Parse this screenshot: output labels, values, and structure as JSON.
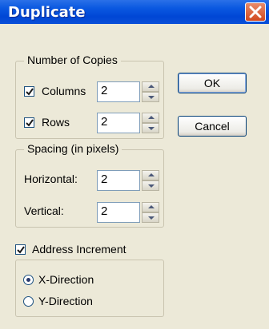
{
  "window": {
    "title": "Duplicate"
  },
  "copies_group": {
    "label": "Number of Copies",
    "columns": {
      "label": "Columns",
      "checked": true,
      "value": "2"
    },
    "rows": {
      "label": "Rows",
      "checked": true,
      "value": "2"
    }
  },
  "spacing_group": {
    "label": "Spacing (in pixels)",
    "horizontal": {
      "label": "Horizontal:",
      "value": "2"
    },
    "vertical": {
      "label": "Vertical:",
      "value": "2"
    }
  },
  "address_increment": {
    "label": "Address Increment",
    "checked": true,
    "options": [
      {
        "label": "X-Direction",
        "selected": true
      },
      {
        "label": "Y-Direction",
        "selected": false
      }
    ]
  },
  "buttons": {
    "ok": "OK",
    "cancel": "Cancel"
  }
}
